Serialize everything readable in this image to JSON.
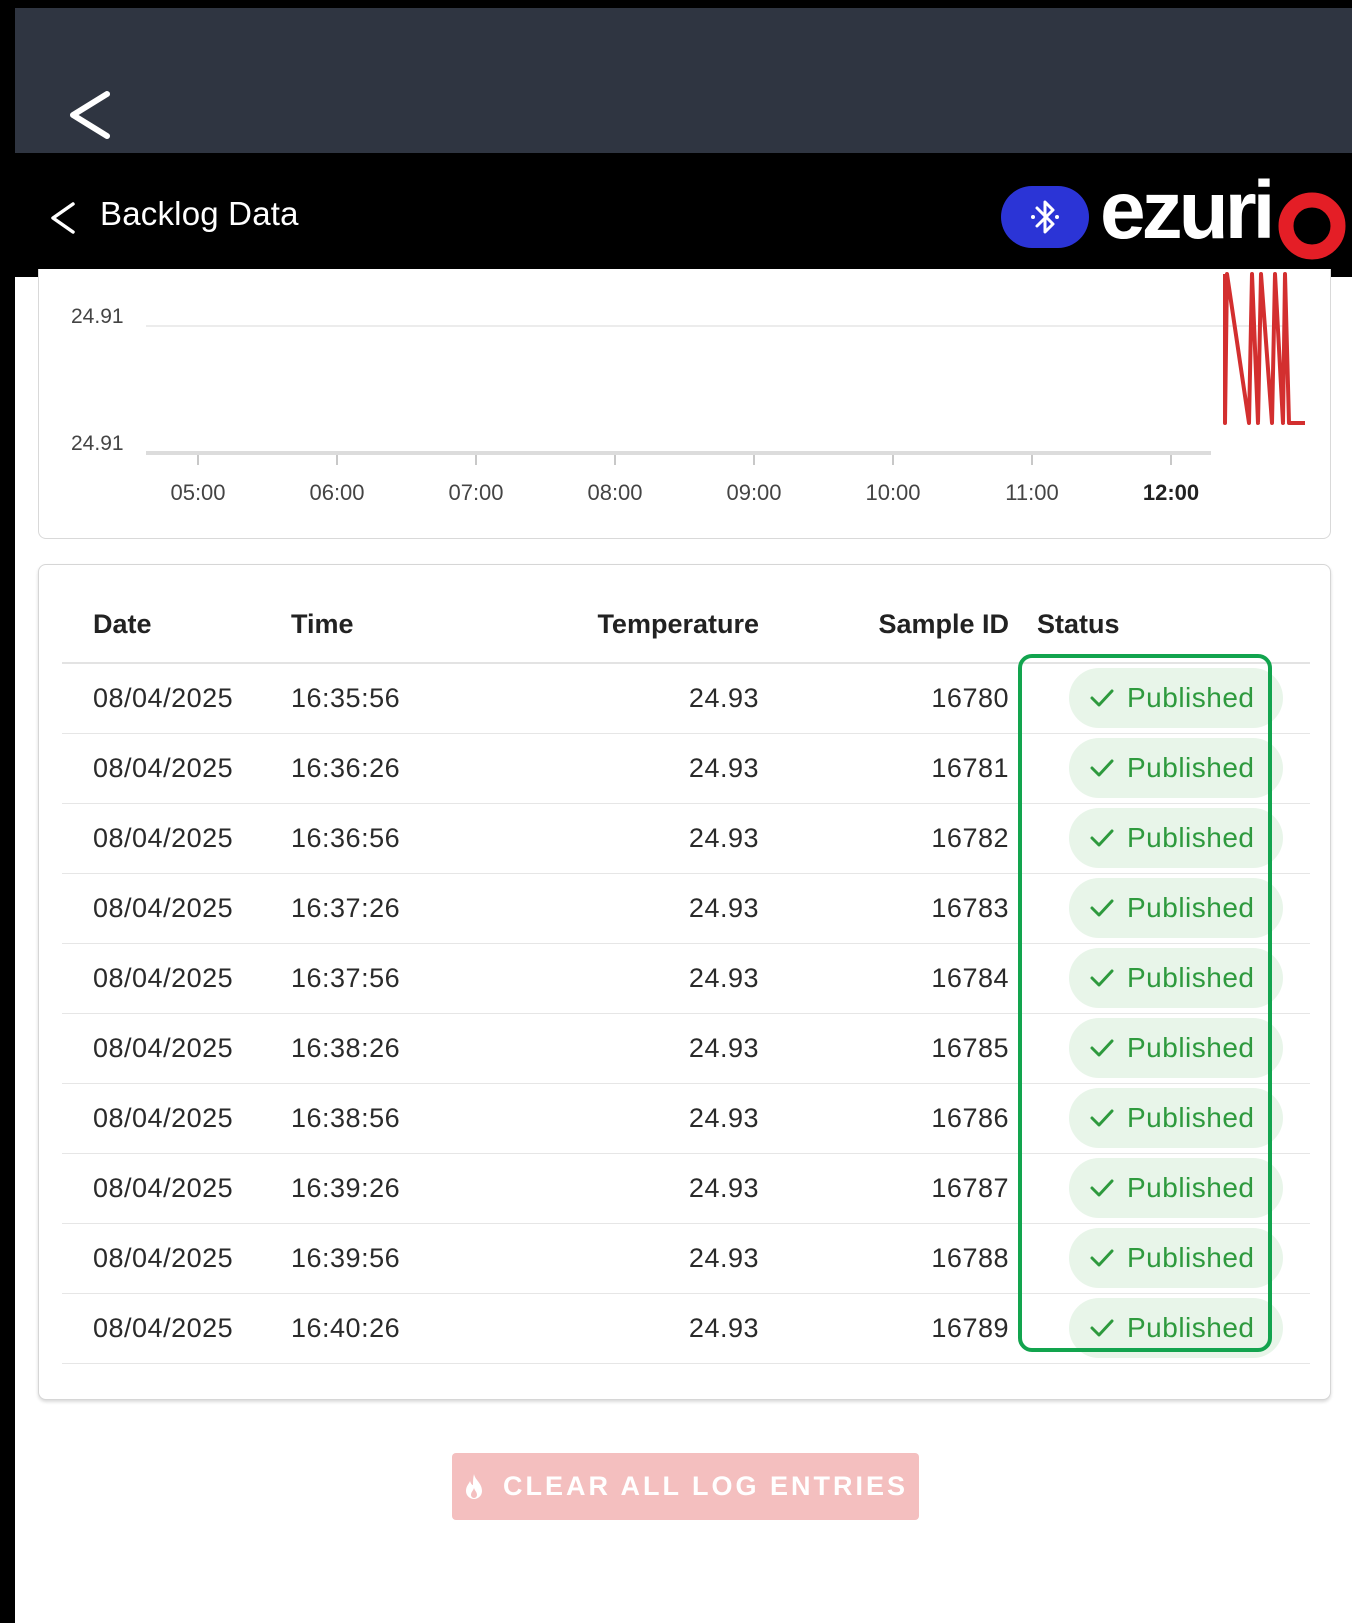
{
  "app_bar": {
    "title": "Backlog Data",
    "brand": "ezurio"
  },
  "chart_data": {
    "type": "line",
    "y_tick_labels": [
      "24.91",
      "24.91"
    ],
    "x_tick_labels": [
      "05:00",
      "06:00",
      "07:00",
      "08:00",
      "09:00",
      "10:00",
      "11:00",
      "12:00"
    ],
    "x_tick_bold": "12:00",
    "series_color": "#d32f2f"
  },
  "table": {
    "headers": [
      "Date",
      "Time",
      "Temperature",
      "Sample ID",
      "Status"
    ],
    "rows": [
      {
        "date": "08/04/2025",
        "time": "16:35:56",
        "temperature": "24.93",
        "sample_id": "16780",
        "status": "Published"
      },
      {
        "date": "08/04/2025",
        "time": "16:36:26",
        "temperature": "24.93",
        "sample_id": "16781",
        "status": "Published"
      },
      {
        "date": "08/04/2025",
        "time": "16:36:56",
        "temperature": "24.93",
        "sample_id": "16782",
        "status": "Published"
      },
      {
        "date": "08/04/2025",
        "time": "16:37:26",
        "temperature": "24.93",
        "sample_id": "16783",
        "status": "Published"
      },
      {
        "date": "08/04/2025",
        "time": "16:37:56",
        "temperature": "24.93",
        "sample_id": "16784",
        "status": "Published"
      },
      {
        "date": "08/04/2025",
        "time": "16:38:26",
        "temperature": "24.93",
        "sample_id": "16785",
        "status": "Published"
      },
      {
        "date": "08/04/2025",
        "time": "16:38:56",
        "temperature": "24.93",
        "sample_id": "16786",
        "status": "Published"
      },
      {
        "date": "08/04/2025",
        "time": "16:39:26",
        "temperature": "24.93",
        "sample_id": "16787",
        "status": "Published"
      },
      {
        "date": "08/04/2025",
        "time": "16:39:56",
        "temperature": "24.93",
        "sample_id": "16788",
        "status": "Published"
      },
      {
        "date": "08/04/2025",
        "time": "16:40:26",
        "temperature": "24.93",
        "sample_id": "16789",
        "status": "Published"
      }
    ]
  },
  "actions": {
    "clear_label": "CLEAR ALL LOG ENTRIES"
  },
  "colors": {
    "status_bar": "#2f3541",
    "app_bar": "#000000",
    "bluetooth_pill": "#2b34d6",
    "brand_red": "#e41e26",
    "published_green": "#2e9a3e",
    "highlight_green": "#12a44e",
    "clear_button": "#f4bfbf"
  },
  "icons": {
    "os_back": "chevron-left-icon",
    "app_back": "chevron-left-icon",
    "bluetooth": "bluetooth-icon",
    "published": "check-icon",
    "clear": "flame-icon"
  }
}
